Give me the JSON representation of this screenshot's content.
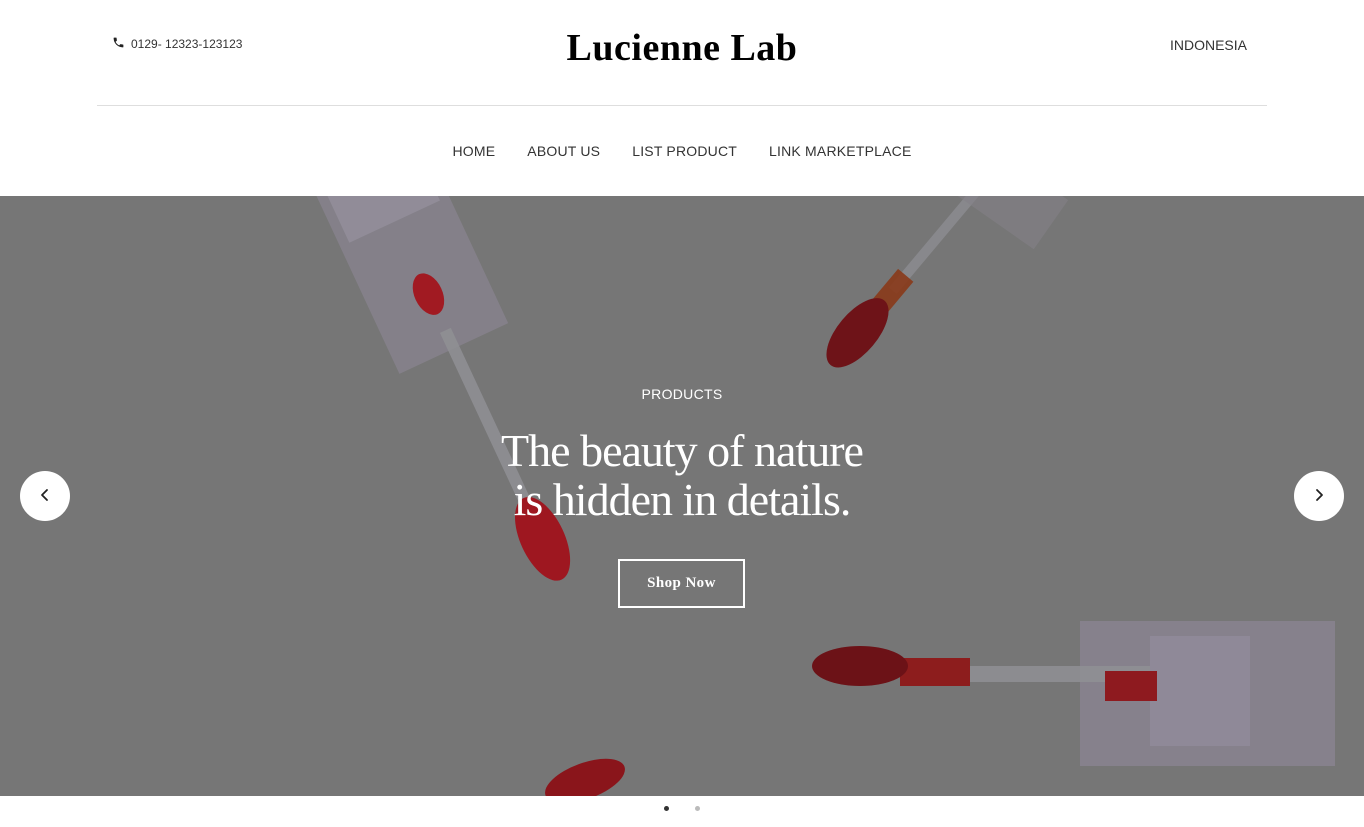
{
  "header": {
    "phone": "0129- 12323-123123",
    "brand": "Lucienne Lab",
    "country": "INDONESIA"
  },
  "nav": {
    "items": [
      {
        "label": "HOME"
      },
      {
        "label": "ABOUT US"
      },
      {
        "label": "LIST PRODUCT"
      },
      {
        "label": "LINK MARKETPLACE"
      }
    ]
  },
  "hero": {
    "eyebrow": "PRODUCTS",
    "headline_line1": "The beauty of nature",
    "headline_line2": "is hidden in details.",
    "cta_label": "Shop Now",
    "prev_icon": "chevron-left-icon",
    "next_icon": "chevron-right-icon",
    "overlay_color": "#6f6f6f",
    "accent_color": "#b3121c"
  },
  "carousel": {
    "slide_count": 2,
    "active_index": 0
  }
}
